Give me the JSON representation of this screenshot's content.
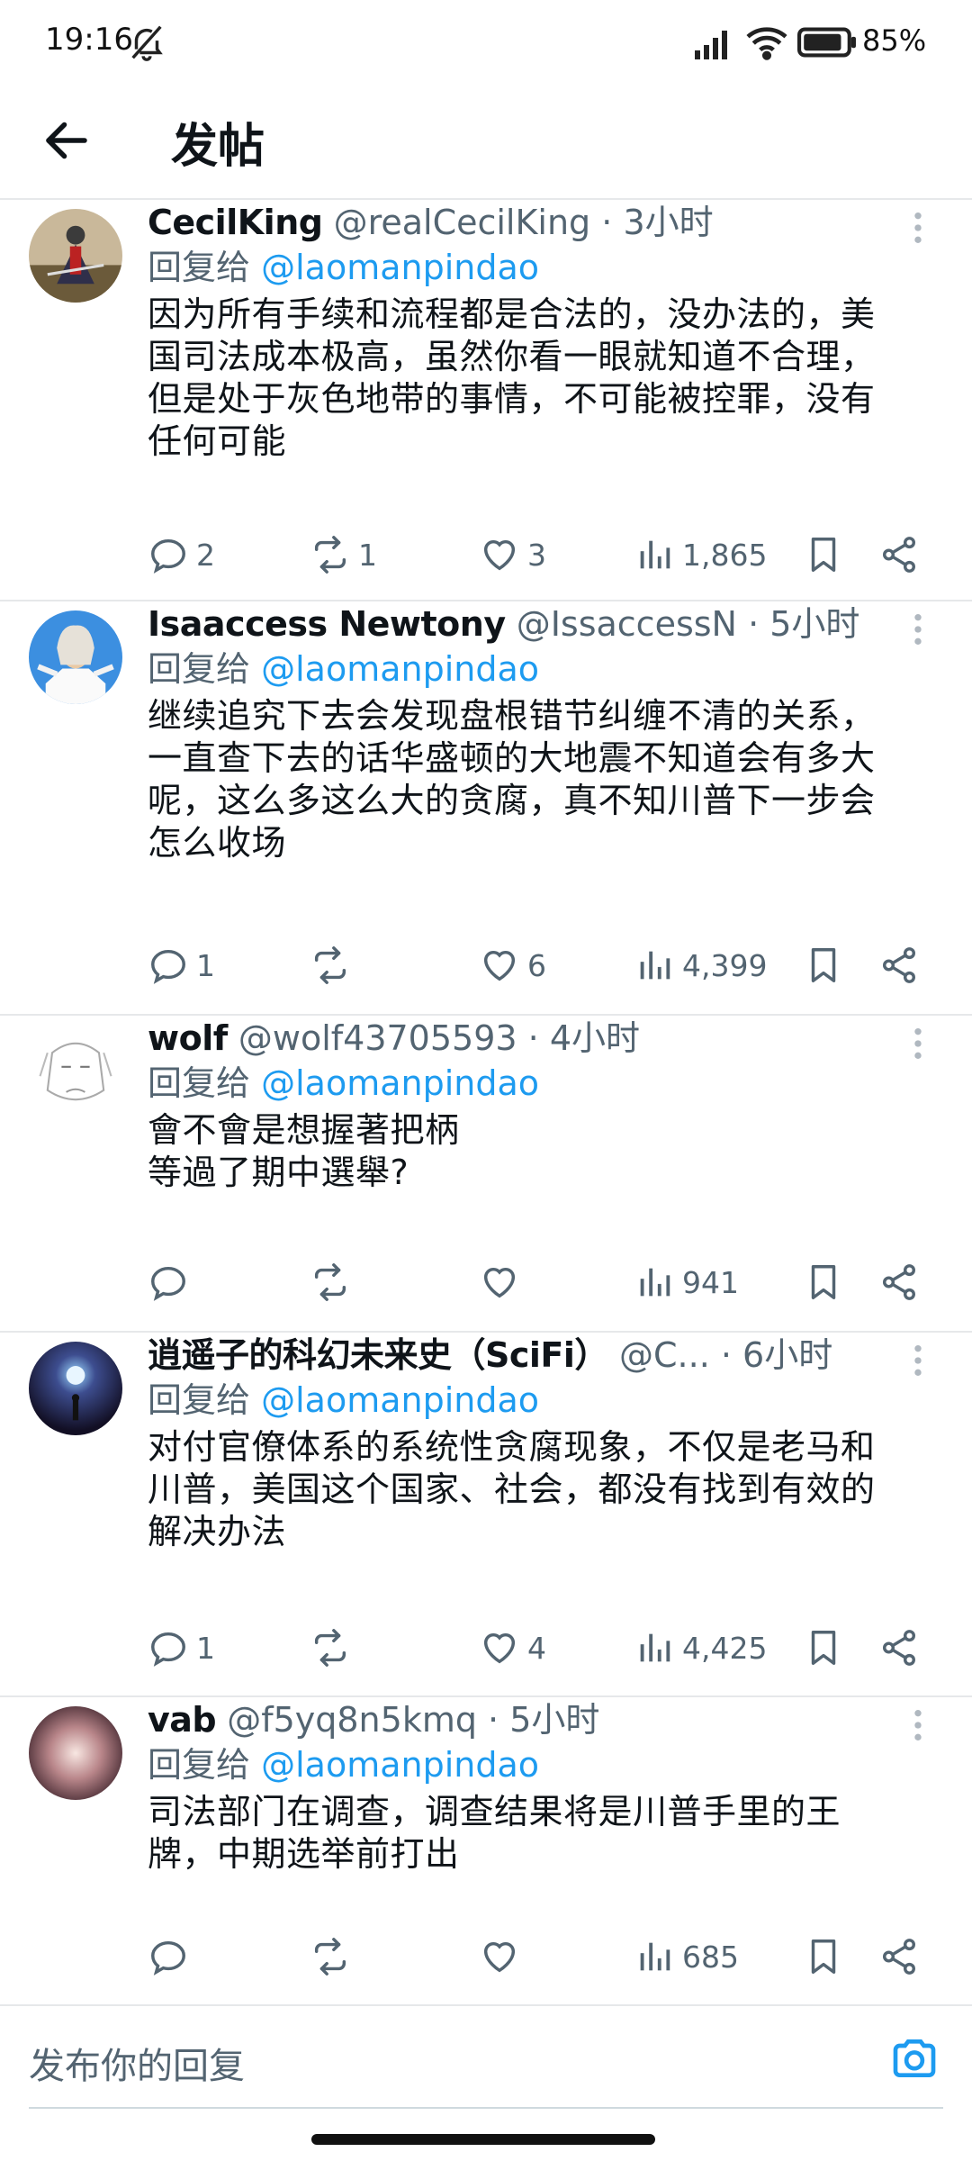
{
  "status_bar": {
    "time": "19:16",
    "battery": "85%"
  },
  "header": {
    "title": "发帖"
  },
  "reply_prefix": "回复给",
  "tweets": [
    {
      "name": "CecilKing",
      "handle": "@realCecilKing",
      "ago": "3小时",
      "reply_to": "@laomanpindao",
      "text": "因为所有手续和流程都是合法的，没办法的，美\n国司法成本极高，虽然你看一眼就知道不合理，\n但是处于灰色地带的事情，不可能被控罪，没有\n任何可能",
      "replies": "2",
      "retweets": "1",
      "likes": "3",
      "views": "1,865"
    },
    {
      "name": "Isaaccess Newtony",
      "handle": "@IssaccessN",
      "ago": "5小时",
      "reply_to": "@laomanpindao",
      "text": "继续追究下去会发现盘根错节纠缠不清的关系，\n一直查下去的话华盛顿的大地震不知道会有多大\n呢，这么多这么大的贪腐，真不知川普下一步会\n怎么收场",
      "replies": "1",
      "retweets": "",
      "likes": "6",
      "views": "4,399"
    },
    {
      "name": "wolf",
      "handle": "@wolf43705593",
      "ago": "4小时",
      "reply_to": "@laomanpindao",
      "text": "會不會是想握著把柄\n等過了期中選舉?",
      "replies": "",
      "retweets": "",
      "likes": "",
      "views": "941"
    },
    {
      "name": "逍遥子的科幻未来史（SciFi）",
      "handle": "@C...",
      "ago": "6小时",
      "reply_to": "@laomanpindao",
      "text": "对付官僚体系的系统性贪腐现象，不仅是老马和\n川普，美国这个国家、社会，都没有找到有效的\n解决办法",
      "replies": "1",
      "retweets": "",
      "likes": "4",
      "views": "4,425"
    },
    {
      "name": "vab",
      "handle": "@f5yq8n5kmq",
      "ago": "5小时",
      "reply_to": "@laomanpindao",
      "text": "司法部门在调查，调查结果将是川普手里的王\n牌，中期选举前打出",
      "replies": "",
      "retweets": "",
      "likes": "",
      "views": "685"
    }
  ],
  "composer": {
    "placeholder": "发布你的回复"
  },
  "colors": {
    "accent": "#1d9bf0",
    "muted": "#536471",
    "text": "#0f1419",
    "divider": "#e6e8ea"
  }
}
